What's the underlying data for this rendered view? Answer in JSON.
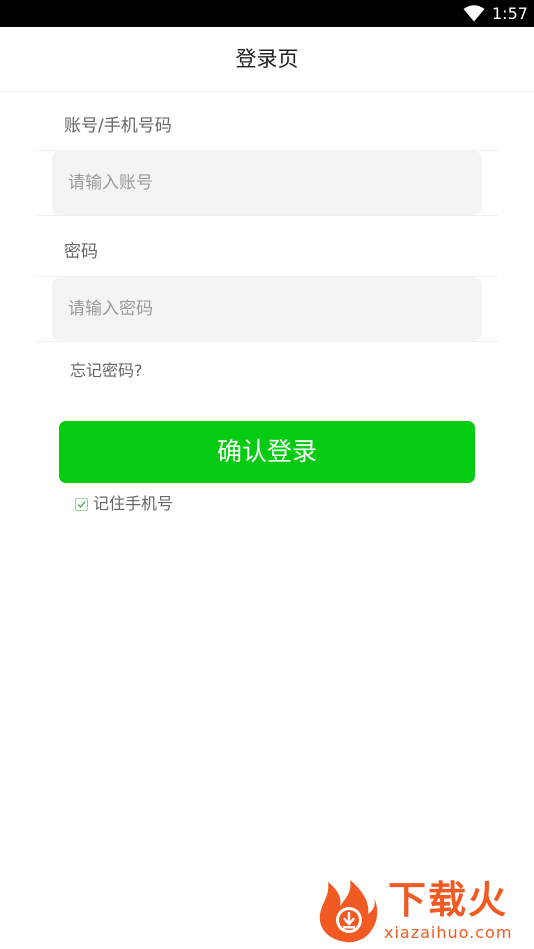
{
  "status_bar": {
    "time": "1:57",
    "wifi_icon": "wifi-icon"
  },
  "header": {
    "title": "登录页"
  },
  "form": {
    "account_label": "账号/手机号码",
    "account_placeholder": "请输入账号",
    "account_value": "",
    "password_label": "密码",
    "password_placeholder": "请输入密码",
    "password_value": "",
    "forgot_label": "忘记密码?",
    "submit_label": "确认登录",
    "remember_label": "记住手机号",
    "remember_checked": true
  },
  "watermark": {
    "name": "下载火",
    "domain": "xiazaihuo.com"
  },
  "colors": {
    "accent": "#05cc12",
    "watermark": "#f15a22",
    "input_bg": "#f4f4f4",
    "status_bar": "#000000"
  }
}
